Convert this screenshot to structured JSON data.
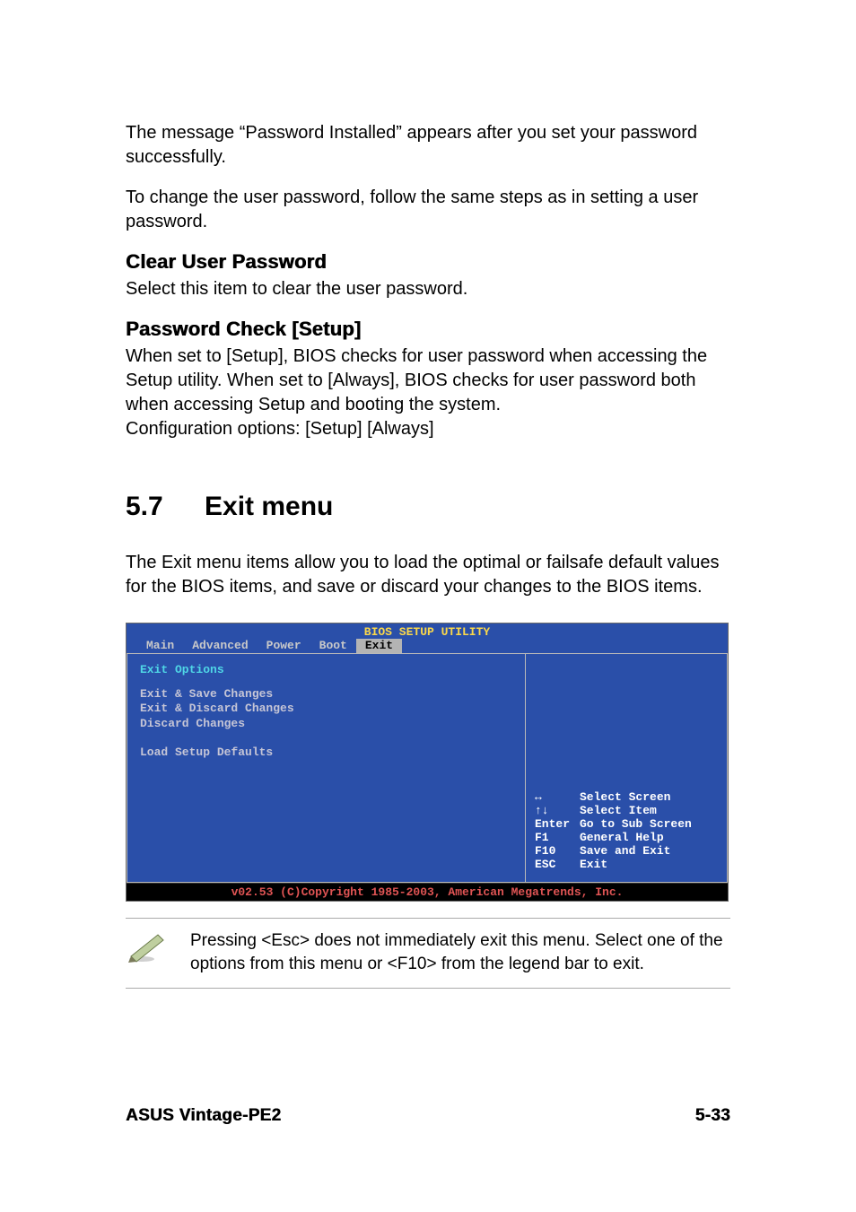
{
  "intro": {
    "p1": "The message “Password Installed” appears after you set your password successfully.",
    "p2": "To change the user password, follow the same steps as in setting a user password."
  },
  "clear": {
    "heading": "Clear User Password",
    "p": "Select this item to clear the user password."
  },
  "check": {
    "heading": "Password Check [Setup]",
    "p1": "When set to [Setup], BIOS checks for user password when accessing the Setup utility. When set to [Always], BIOS checks for user password both when accessing Setup and booting the system.",
    "p2": "Configuration options: [Setup] [Always]"
  },
  "section": {
    "num": "5.7",
    "title": "Exit menu",
    "p": "The Exit menu items allow you to load the optimal or failsafe default values for the BIOS items, and save or discard your changes to the BIOS items."
  },
  "bios": {
    "title": "BIOS SETUP UTILITY",
    "tabs": [
      "Main",
      "Advanced",
      "Power",
      "Boot",
      "Exit"
    ],
    "selected_tab": "Exit",
    "section_label": "Exit Options",
    "items": [
      "Exit & Save Changes",
      "Exit & Discard Changes",
      "Discard Changes",
      "",
      "Load Setup Defaults"
    ],
    "help": [
      {
        "key": "↔",
        "val": "Select Screen"
      },
      {
        "key": "↑↓",
        "val": "Select Item"
      },
      {
        "key": "Enter",
        "val": "Go to Sub Screen"
      },
      {
        "key": "F1",
        "val": "General Help"
      },
      {
        "key": "F10",
        "val": "Save and Exit"
      },
      {
        "key": "ESC",
        "val": "Exit"
      }
    ],
    "footer": "v02.53 (C)Copyright 1985-2003, American Megatrends, Inc."
  },
  "note": "Pressing <Esc> does not immediately exit this menu. Select one of the options from this menu or <F10> from the legend bar to exit.",
  "footer": {
    "left": "ASUS Vintage-PE2",
    "right": "5-33"
  }
}
